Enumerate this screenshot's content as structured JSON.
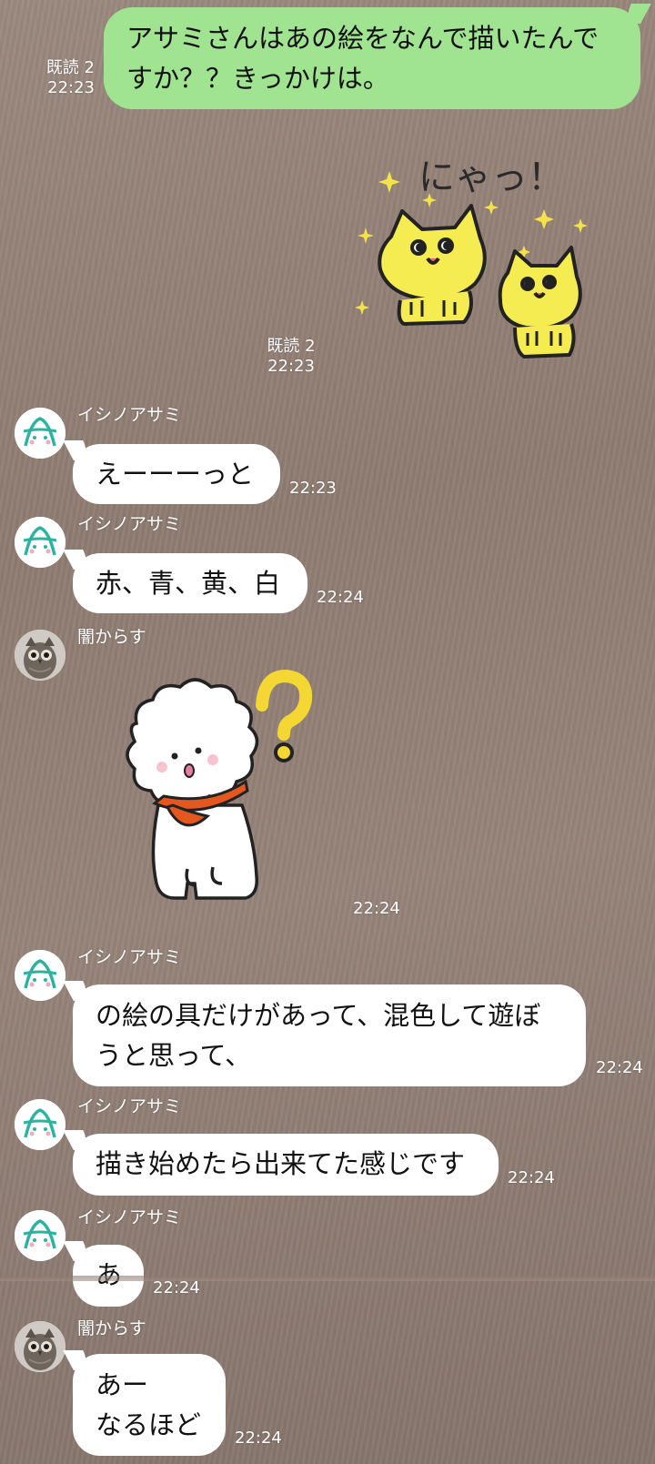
{
  "messages": [
    {
      "id": "m1",
      "direction": "out",
      "text": "アサミさんはあの絵をなんで描いたんで\nすか？？きっかけは。",
      "read": "既読 2",
      "time": "22:23"
    },
    {
      "id": "m2",
      "direction": "out",
      "type": "sticker",
      "sticker_icon": "two-yellow-cats-sticker",
      "sticker_text": "にゃっ！",
      "read": "既読 2",
      "time": "22:23"
    },
    {
      "id": "m3",
      "direction": "in",
      "sender": "イシノアサミ",
      "text": "えーーーっと",
      "time": "22:23"
    },
    {
      "id": "m4",
      "direction": "in",
      "sender": "イシノアサミ",
      "text": "赤、青、黄、白",
      "time": "22:24"
    },
    {
      "id": "m5",
      "direction": "in",
      "sender": "闇からす",
      "type": "sticker",
      "sticker_icon": "fluffy-white-dog-question-sticker",
      "time": "22:24"
    },
    {
      "id": "m6",
      "direction": "in",
      "sender": "イシノアサミ",
      "text": "の絵の具だけがあって、混色して遊ぼ\nうと思って、",
      "time": "22:24"
    },
    {
      "id": "m7",
      "direction": "in",
      "sender": "イシノアサミ",
      "text": "描き始めたら出来てた感じです",
      "time": "22:24"
    },
    {
      "id": "m8",
      "direction": "in",
      "sender": "イシノアサミ",
      "text": "あ",
      "time": "22:24"
    },
    {
      "id": "m9",
      "direction": "in",
      "sender": "闇からす",
      "text": "あー\nなるほど",
      "time": "22:24"
    }
  ],
  "avatars": {
    "asami": {
      "icon": "asami-letter-a-avatar-icon",
      "color": "#2bb3a0"
    },
    "karasu": {
      "icon": "owl-photo-avatar-icon"
    }
  },
  "colors": {
    "outgoing_bubble": "#a0e390",
    "incoming_bubble": "#ffffff",
    "background": "#8f7d73"
  }
}
